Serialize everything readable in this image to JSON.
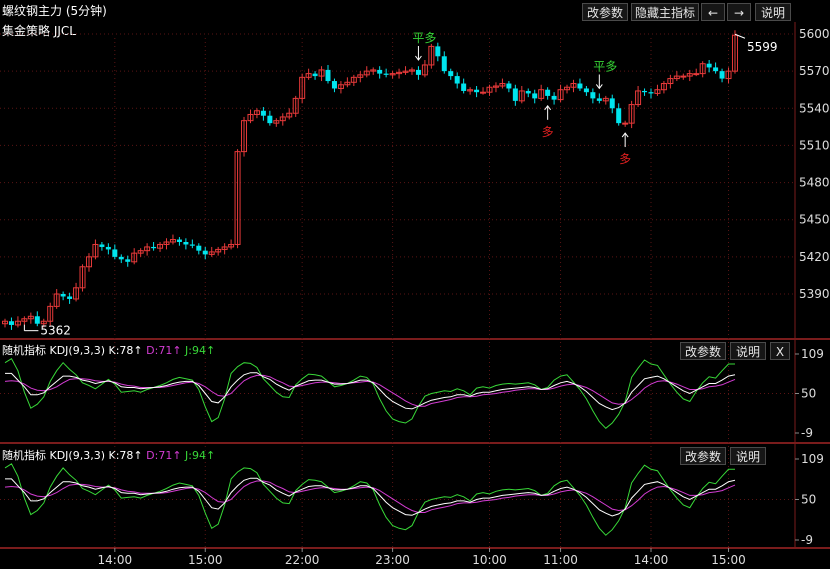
{
  "header": {
    "title": "螺纹钢主力 (5分钟)",
    "strategy": "集金策略 JJCL",
    "buttons": {
      "modify_params": "改参数",
      "hide_indicator": "隐藏主指标",
      "prev": "←",
      "next": "→",
      "help": "说明"
    }
  },
  "price_axis": {
    "ticks": [
      "5600",
      "5570",
      "5540",
      "5510",
      "5480",
      "5450",
      "5420",
      "5390"
    ]
  },
  "time_axis": {
    "ticks": [
      "14:00",
      "15:00",
      "22:00",
      "23:00",
      "10:00",
      "11:00",
      "14:00",
      "15:00"
    ]
  },
  "annotations": {
    "last_price": "5599",
    "low_price": "5362",
    "signals": [
      {
        "text": "平多",
        "color": "#36d436",
        "type": "flat"
      },
      {
        "text": "多",
        "color": "#e02020",
        "type": "long"
      },
      {
        "text": "平多",
        "color": "#36d436",
        "type": "flat"
      },
      {
        "text": "多",
        "color": "#e02020",
        "type": "long"
      }
    ]
  },
  "kdj_panels": [
    {
      "title": "随机指标",
      "name": "KDJ(9,3,3)",
      "k": "K:78↑",
      "d": "D:71↑",
      "j": "J:94↑",
      "buttons": {
        "modify_params": "改参数",
        "help": "说明",
        "close": "X"
      },
      "ticks": [
        "109",
        "50",
        "-9"
      ]
    },
    {
      "title": "随机指标",
      "name": "KDJ(9,3,3)",
      "k": "K:78↑",
      "d": "D:71↑",
      "j": "J:94↑",
      "buttons": {
        "modify_params": "改参数",
        "help": "说明"
      },
      "ticks": [
        "109",
        "50",
        "-9"
      ]
    }
  ],
  "colors": {
    "up": "#e83a3a",
    "down": "#00e5ee",
    "k": "#ffffff",
    "d": "#d23cd2",
    "j": "#38d838",
    "grid": "#5a1414",
    "text": "#dddddd"
  },
  "chart_data": {
    "type": "candlestick",
    "symbol": "螺纹钢主力",
    "interval": "5分钟",
    "ylim": [
      5360,
      5610
    ],
    "y_ticks": [
      5390,
      5420,
      5450,
      5480,
      5510,
      5540,
      5570,
      5600
    ],
    "x_ticks": [
      "14:00",
      "15:00",
      "22:00",
      "23:00",
      "10:00",
      "11:00",
      "14:00",
      "15:00"
    ],
    "close": [
      5368,
      5365,
      5368,
      5370,
      5372,
      5366,
      5368,
      5380,
      5390,
      5388,
      5386,
      5395,
      5412,
      5420,
      5430,
      5428,
      5426,
      5420,
      5418,
      5416,
      5423,
      5425,
      5428,
      5427,
      5430,
      5432,
      5434,
      5432,
      5430,
      5429,
      5425,
      5422,
      5424,
      5426,
      5428,
      5430,
      5505,
      5530,
      5535,
      5538,
      5534,
      5528,
      5530,
      5533,
      5536,
      5548,
      5565,
      5568,
      5566,
      5571,
      5562,
      5556,
      5559,
      5561,
      5565,
      5567,
      5570,
      5571,
      5568,
      5567,
      5568,
      5569,
      5570,
      5571,
      5567,
      5575,
      5590,
      5582,
      5570,
      5566,
      5560,
      5554,
      5555,
      5553,
      5553,
      5557,
      5558,
      5560,
      5556,
      5546,
      5554,
      5552,
      5548,
      5555,
      5550,
      5547,
      5555,
      5557,
      5560,
      5556,
      5553,
      5548,
      5546,
      5548,
      5540,
      5528,
      5528,
      5543,
      5554,
      5553,
      5552,
      5555,
      5560,
      5564,
      5566,
      5566,
      5568,
      5568,
      5576,
      5573,
      5570,
      5564,
      5570,
      5599
    ],
    "kdj_scale": [
      -9,
      109
    ],
    "K": [
      80,
      80,
      70,
      60,
      48,
      48,
      51,
      60,
      68,
      76,
      76,
      74,
      70,
      68,
      65,
      67,
      69,
      66,
      60,
      59,
      59,
      57,
      58,
      59,
      60,
      62,
      65,
      67,
      68,
      68,
      62,
      50,
      38,
      36,
      45,
      60,
      70,
      78,
      81,
      81,
      75,
      71,
      64,
      59,
      55,
      61,
      65,
      69,
      70,
      70,
      67,
      64,
      64,
      65,
      67,
      70,
      70,
      66,
      56,
      46,
      38,
      33,
      28,
      27,
      31,
      36,
      40,
      42,
      44,
      45,
      48,
      48,
      46,
      50,
      52,
      52,
      54,
      56,
      57,
      58,
      59,
      60,
      59,
      56,
      57,
      62,
      66,
      68,
      65,
      60,
      53,
      44,
      35,
      30,
      26,
      29,
      36,
      52,
      62,
      72,
      74,
      76,
      72,
      66,
      60,
      54,
      50,
      55,
      60,
      65,
      65,
      70,
      76,
      78
    ],
    "D": [
      68,
      69,
      68,
      64,
      58,
      55,
      54,
      56,
      60,
      66,
      71,
      72,
      72,
      71,
      69,
      68,
      68,
      67,
      64,
      62,
      61,
      59,
      59,
      59,
      59,
      60,
      62,
      64,
      66,
      67,
      65,
      60,
      53,
      47,
      46,
      50,
      60,
      69,
      74,
      77,
      77,
      75,
      70,
      66,
      61,
      60,
      62,
      64,
      66,
      67,
      67,
      66,
      65,
      65,
      66,
      67,
      68,
      67,
      63,
      57,
      51,
      45,
      39,
      34,
      31,
      31,
      35,
      37,
      39,
      41,
      44,
      45,
      45,
      46,
      48,
      49,
      50,
      52,
      53,
      55,
      56,
      57,
      57,
      56,
      56,
      58,
      61,
      63,
      64,
      62,
      59,
      54,
      48,
      42,
      36,
      34,
      35,
      41,
      49,
      58,
      64,
      68,
      69,
      67,
      64,
      60,
      56,
      56,
      57,
      60,
      61,
      63,
      67,
      71
    ],
    "J": [
      96,
      102,
      84,
      52,
      28,
      34,
      45,
      68,
      84,
      96,
      86,
      78,
      66,
      62,
      57,
      64,
      71,
      64,
      52,
      53,
      54,
      52,
      56,
      59,
      62,
      66,
      71,
      74,
      72,
      70,
      56,
      30,
      8,
      14,
      42,
      80,
      90,
      96,
      95,
      89,
      72,
      62,
      52,
      45,
      44,
      63,
      72,
      79,
      78,
      76,
      68,
      60,
      62,
      65,
      70,
      76,
      74,
      64,
      42,
      24,
      12,
      8,
      6,
      12,
      31,
      46,
      50,
      52,
      54,
      53,
      57,
      54,
      48,
      58,
      60,
      58,
      62,
      64,
      65,
      64,
      65,
      66,
      63,
      56,
      59,
      70,
      76,
      78,
      67,
      56,
      42,
      24,
      8,
      -2,
      6,
      19,
      38,
      74,
      88,
      100,
      94,
      92,
      78,
      64,
      52,
      42,
      38,
      53,
      66,
      75,
      73,
      84,
      94,
      94
    ]
  }
}
